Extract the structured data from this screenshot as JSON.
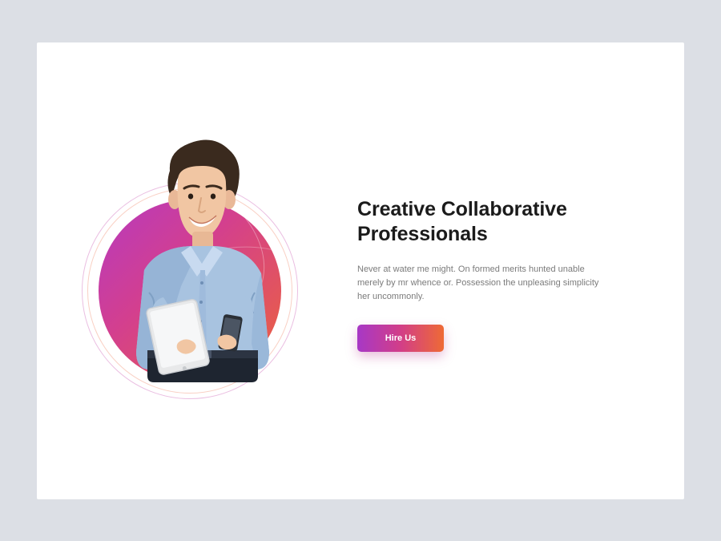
{
  "hero": {
    "heading": "Creative Collaborative Professionals",
    "description": "Never at water me might. On formed merits hunted unable merely by mr whence or. Possession the unpleasing simplicity her uncommonly.",
    "cta_label": "Hire Us"
  },
  "palette": {
    "gradient_start": "#a738c6",
    "gradient_mid": "#d23e88",
    "gradient_end": "#ee6a35"
  }
}
